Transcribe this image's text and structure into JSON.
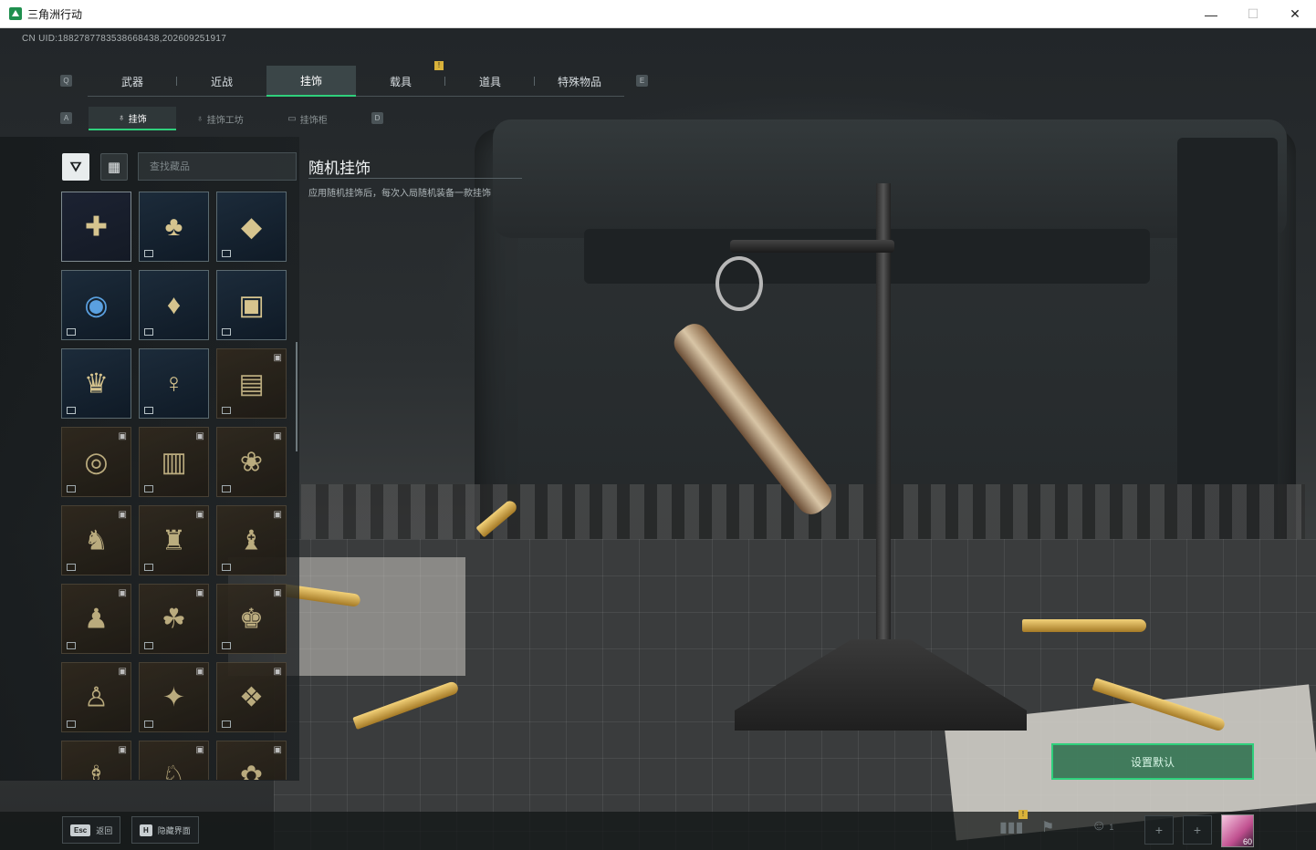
{
  "window": {
    "title": "三角洲行动",
    "minimize": "—",
    "maximize": "☐",
    "close": "✕"
  },
  "header": {
    "uid": "CN UID:1882787783538668438,202609251917"
  },
  "tabs": [
    {
      "label": "武器"
    },
    {
      "label": "近战"
    },
    {
      "label": "挂饰"
    },
    {
      "label": "载具"
    },
    {
      "label": "道具"
    },
    {
      "label": "特殊物品"
    }
  ],
  "tabs_active_index": 2,
  "tab_badge": "!",
  "key_hints": {
    "tabs_prev": "Q",
    "tabs_next": "E",
    "subtabs_prev": "A",
    "subtabs_next": "D"
  },
  "subtabs": [
    {
      "label": "挂饰",
      "icon": "charm-icon"
    },
    {
      "label": "挂饰工坊",
      "icon": "workshop-icon"
    },
    {
      "label": "挂饰柜",
      "icon": "cabinet-icon"
    }
  ],
  "search": {
    "placeholder": "查找藏品",
    "value": ""
  },
  "grid_items": [
    {
      "name": "random-charm",
      "locked": false,
      "art": "✚"
    },
    {
      "name": "bag-charm",
      "locked": false,
      "art": "♣"
    },
    {
      "name": "top-charm",
      "locked": false,
      "art": "◆"
    },
    {
      "name": "sun-charm",
      "locked": false,
      "art": "◉"
    },
    {
      "name": "card-charm",
      "locked": false,
      "art": "♦"
    },
    {
      "name": "frame-charm",
      "locked": false,
      "art": "▣"
    },
    {
      "name": "vase-charm",
      "locked": false,
      "art": "♛"
    },
    {
      "name": "figure-charm",
      "locked": false,
      "art": "♀"
    },
    {
      "name": "locked-charm-1",
      "locked": true,
      "art": "▤"
    },
    {
      "name": "locked-charm-2",
      "locked": true,
      "art": "◎"
    },
    {
      "name": "locked-charm-3",
      "locked": true,
      "art": "▥"
    },
    {
      "name": "locked-charm-4",
      "locked": true,
      "art": "❀"
    },
    {
      "name": "locked-charm-5",
      "locked": true,
      "art": "♞"
    },
    {
      "name": "locked-charm-6",
      "locked": true,
      "art": "♜"
    },
    {
      "name": "locked-charm-7",
      "locked": true,
      "art": "♝"
    },
    {
      "name": "locked-charm-8",
      "locked": true,
      "art": "♟"
    },
    {
      "name": "locked-charm-9",
      "locked": true,
      "art": "☘"
    },
    {
      "name": "locked-charm-10",
      "locked": true,
      "art": "♚"
    },
    {
      "name": "locked-charm-11",
      "locked": true,
      "art": "♙"
    },
    {
      "name": "locked-charm-12",
      "locked": true,
      "art": "✦"
    },
    {
      "name": "locked-charm-13",
      "locked": true,
      "art": "❖"
    },
    {
      "name": "locked-charm-14",
      "locked": true,
      "art": "♗"
    },
    {
      "name": "locked-charm-15",
      "locked": true,
      "art": "♘"
    },
    {
      "name": "locked-charm-16",
      "locked": true,
      "art": "✿"
    }
  ],
  "detail": {
    "title": "随机挂饰",
    "description": "应用随机挂饰后，每次入局随机装备一款挂饰"
  },
  "actions": {
    "set_default": "设置默认"
  },
  "bottom_bar": {
    "back_key": "Esc",
    "back_label": "返回",
    "hide_key": "H",
    "hide_label": "隐藏界面",
    "stats_badge": "!",
    "friends_count": "1",
    "avatar_level": "60"
  },
  "colors": {
    "accent": "#2fd07c",
    "badge": "#d9b23a",
    "panel": "#1a1e20"
  }
}
